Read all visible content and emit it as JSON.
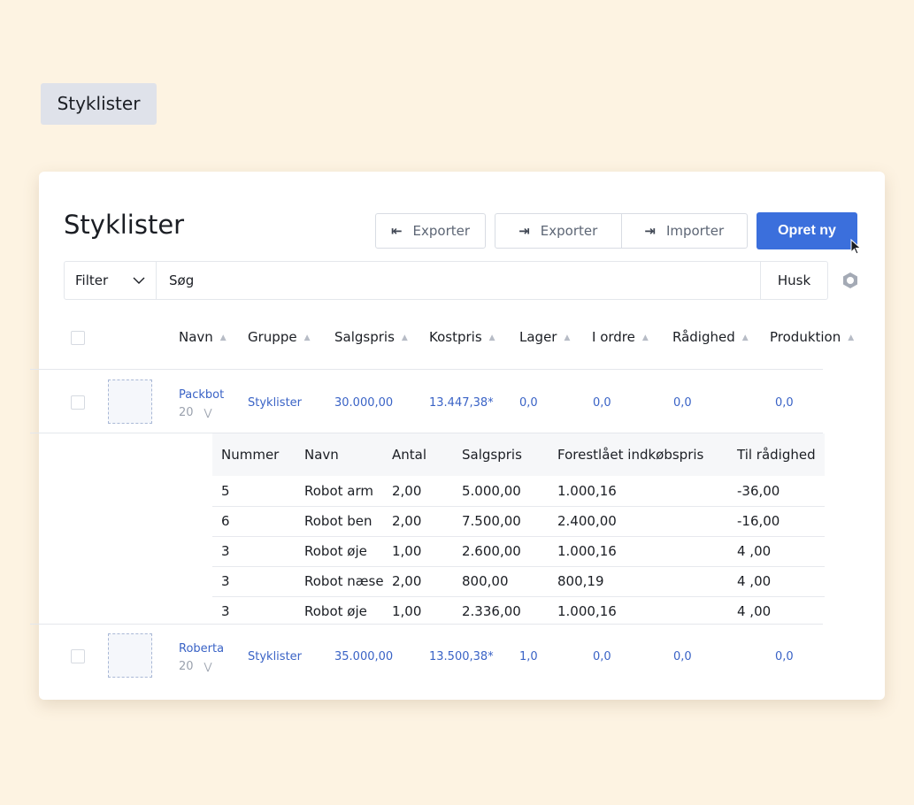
{
  "page_tag": "Styklister",
  "title": "Styklister",
  "toolbar": {
    "export_label": "Exporter",
    "export2_label": "Exporter",
    "import_label": "Importer",
    "new_label": "Opret ny"
  },
  "filter": {
    "label": "Filter",
    "search_placeholder": "Søg",
    "save_label": "Husk"
  },
  "columns": [
    "Navn",
    "Gruppe",
    "Salgspris",
    "Kostpris",
    "Lager",
    "I ordre",
    "Rådighed",
    "Produktion"
  ],
  "rows": [
    {
      "name": "Packbot",
      "qty": "20",
      "group": "Styklister",
      "price": "30.000,00",
      "cost": "13.447,38*",
      "stock": "0,0",
      "in_order": "0,0",
      "available": "0,0",
      "production": "0,0"
    },
    {
      "name": "Roberta",
      "qty": "20",
      "group": "Styklister",
      "price": "35.000,00",
      "cost": "13.500,38*",
      "stock": "1,0",
      "in_order": "0,0",
      "available": "0,0",
      "production": "0,0"
    }
  ],
  "sub_columns": [
    "Nummer",
    "Navn",
    "Antal",
    "Salgspris",
    "Forestlået indkøbspris",
    "Til rådighed"
  ],
  "sub_rows": [
    {
      "number": "5",
      "name": "Robot arm",
      "qty": "2,00",
      "price": "5.000,00",
      "purchase": "1.000,16",
      "available": "-36,00"
    },
    {
      "number": "6",
      "name": "Robot ben",
      "qty": "2,00",
      "price": "7.500,00",
      "purchase": "2.400,00",
      "available": "-16,00"
    },
    {
      "number": "3",
      "name": "Robot øje",
      "qty": "1,00",
      "price": "2.600,00",
      "purchase": "1.000,16",
      "available": "4 ,00"
    },
    {
      "number": "3",
      "name": "Robot næse",
      "qty": "2,00",
      "price": "800,00",
      "purchase": "800,19",
      "available": "4 ,00"
    },
    {
      "number": "3",
      "name": "Robot øje",
      "qty": "1,00",
      "price": "2.336,00",
      "purchase": "1.000,16",
      "available": "4 ,00"
    }
  ],
  "colors": {
    "accent": "#3b6fdc",
    "link": "#3a63c6",
    "background": "#fdf3e2"
  }
}
